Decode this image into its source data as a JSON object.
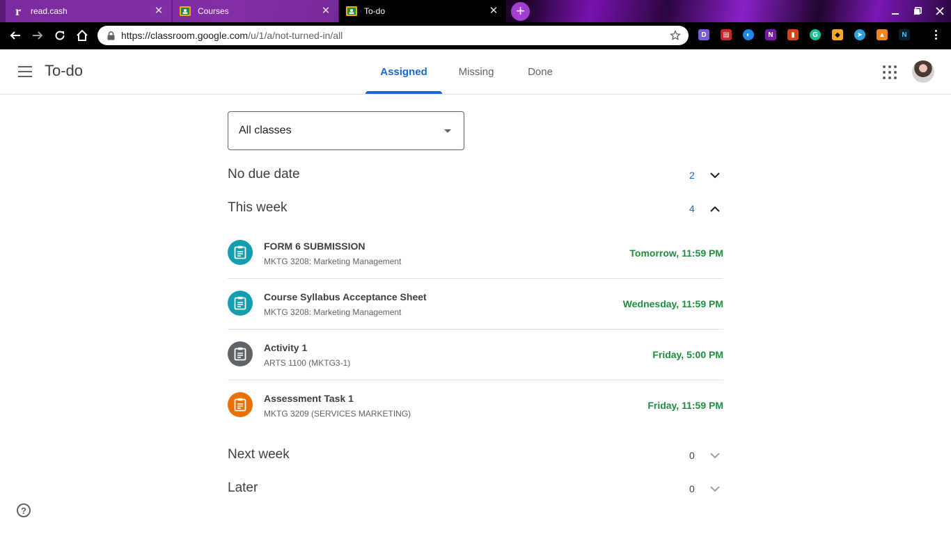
{
  "browser": {
    "tabs": [
      {
        "title": "read.cash",
        "favicon": "r"
      },
      {
        "title": "Courses"
      },
      {
        "title": "To-do"
      }
    ],
    "new_tab_label": "+",
    "url": {
      "host": "https://classroom.google.com",
      "path": "/u/1/a/not-turned-in/all"
    },
    "accent_color": "#a23fd1"
  },
  "header": {
    "title": "To-do",
    "tabs": [
      {
        "label": "Assigned",
        "selected": true
      },
      {
        "label": "Missing"
      },
      {
        "label": "Done"
      }
    ]
  },
  "filter": {
    "selected": "All classes"
  },
  "sections": {
    "no_due": {
      "name": "No due date",
      "count": "2"
    },
    "this_week": {
      "name": "This week",
      "count": "4"
    },
    "next_week": {
      "name": "Next week",
      "count": "0"
    },
    "later": {
      "name": "Later",
      "count": "0"
    }
  },
  "items": [
    {
      "title": "FORM 6 SUBMISSION",
      "class": "MKTG 3208: Marketing Management",
      "due": "Tomorrow, 11:59 PM",
      "color": "#129eaf"
    },
    {
      "title": "Course Syllabus Acceptance Sheet",
      "class": "MKTG 3208: Marketing Management",
      "due": "Wednesday, 11:59 PM",
      "color": "#129eaf"
    },
    {
      "title": "Activity 1",
      "class": "ARTS 1100 (MKTG3-1)",
      "due": "Friday, 5:00 PM",
      "color": "#5f6368"
    },
    {
      "title": "Assessment Task 1",
      "class": "MKTG 3209 (SERVICES MARKETING)",
      "due": "Friday, 11:59 PM",
      "color": "#e8710a"
    }
  ],
  "help_label": "?"
}
